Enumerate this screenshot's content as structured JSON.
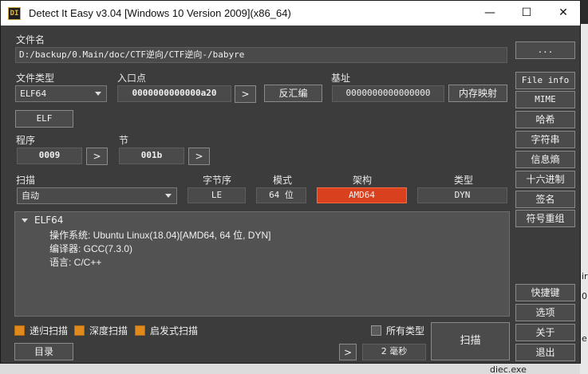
{
  "window": {
    "title": "Detect It Easy v3.04 [Windows 10 Version 2009](x86_64)",
    "icon_text": "DI",
    "controls": {
      "minimize": "—",
      "maximize": "☐",
      "close": "✕"
    }
  },
  "file": {
    "label": "文件名",
    "path": "D:/backup/0.Main/doc/CTF逆向/CTF逆向-/babyre",
    "browse_label": "..."
  },
  "file_type": {
    "label": "文件类型",
    "value": "ELF64",
    "type_button": "ELF"
  },
  "entry": {
    "label": "入口点",
    "value": "0000000000000a20",
    "go": ">",
    "disasm_label": "反汇编"
  },
  "base": {
    "label": "基址",
    "value": "0000000000000000",
    "memmap_label": "内存映射"
  },
  "programs": {
    "label": "程序",
    "value": "0009",
    "go": ">"
  },
  "sections": {
    "label": "节",
    "value": "001b",
    "go": ">"
  },
  "scan": {
    "label": "扫描",
    "mode": "自动",
    "endianness_label": "字节序",
    "endianness": "LE",
    "mode_label": "模式",
    "bits": "64 位",
    "arch_label": "架构",
    "arch": "AMD64",
    "type_label": "类型",
    "type": "DYN"
  },
  "results": {
    "root": "ELF64",
    "lines": [
      "操作系统: Ubuntu Linux(18.04)[AMD64, 64 位, DYN]",
      "编译器: GCC(7.3.0)",
      "语言: C/C++"
    ]
  },
  "options": {
    "recursive": "递归扫描",
    "deep": "深度扫描",
    "heuristic": "启发式扫描",
    "all_types": "所有类型"
  },
  "bottom": {
    "dir_label": "目录",
    "go": ">",
    "time": "2 毫秒",
    "scan_button": "扫描"
  },
  "sidebar": {
    "top": [
      "File info",
      "MIME",
      "哈希",
      "字符串",
      "信息熵",
      "十六进制",
      "签名",
      "符号重组"
    ],
    "bottom": [
      "快捷键",
      "选项",
      "关于",
      "退出"
    ]
  },
  "background": {
    "file_label": "diec.exe",
    "right_char_1": "ir",
    "right_char_2": "0",
    "right_char_3": "e"
  },
  "colors": {
    "accent_orange": "#e08a1e",
    "arch_red": "#d9411e",
    "window_bg": "#3c3c3c"
  }
}
